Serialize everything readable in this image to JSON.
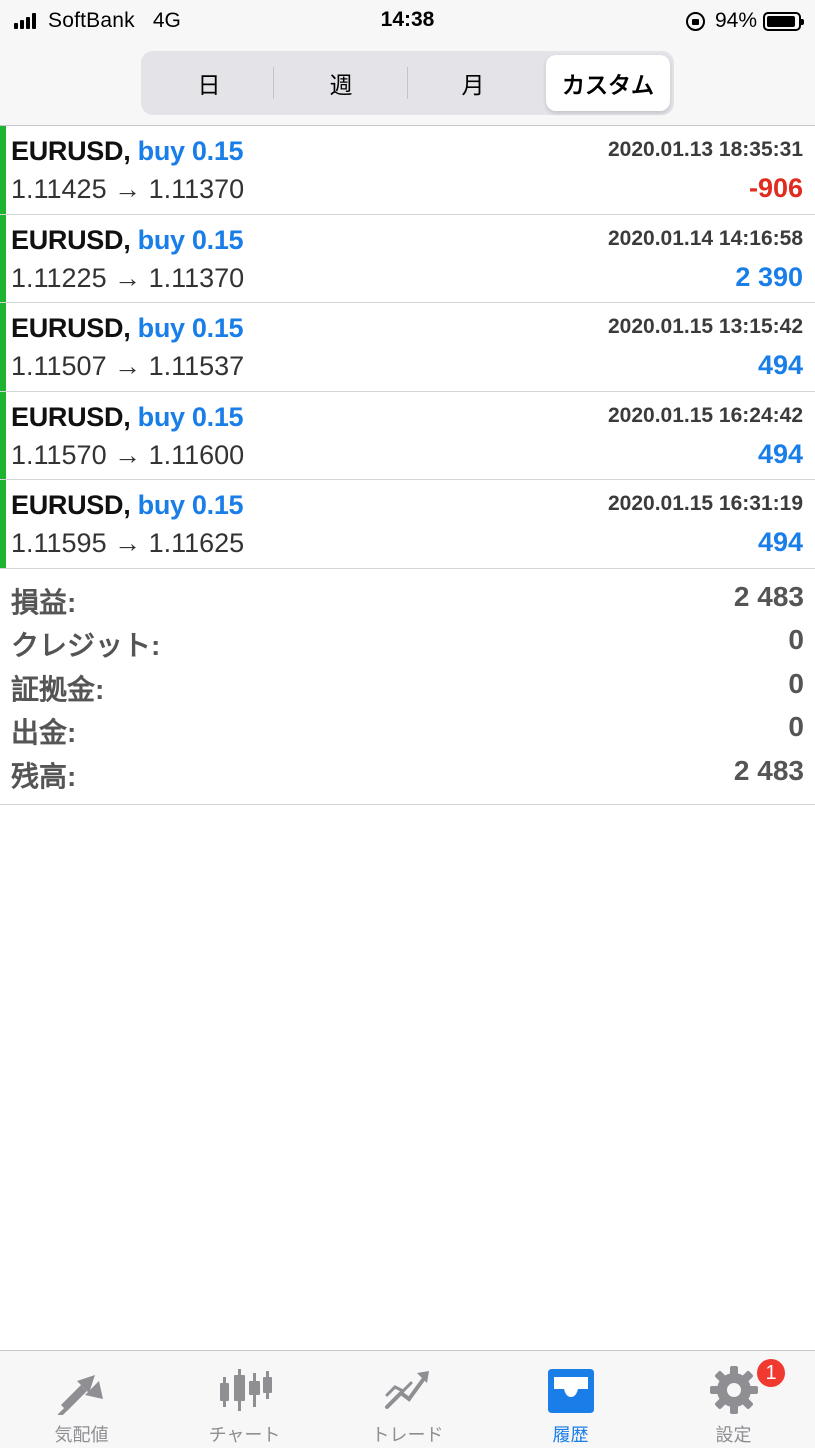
{
  "status_bar": {
    "carrier": "SoftBank",
    "network": "4G",
    "time": "14:38",
    "battery": "94%",
    "battery_level": 0.94
  },
  "period_tabs": {
    "items": [
      "日",
      "週",
      "月",
      "カスタム"
    ],
    "selected": "カスタム"
  },
  "deals": [
    {
      "symbol": "EURUSD,",
      "type": "buy 0.15",
      "time": "2020.01.13 18:35:31",
      "prices": "1.11425 → 1.11370",
      "profit": "-906",
      "profit_color": "#e02b1e"
    },
    {
      "symbol": "EURUSD,",
      "type": "buy 0.15",
      "time": "2020.01.14 14:16:58",
      "prices": "1.11225 → 1.11370",
      "profit": "2 390",
      "profit_color": "#1a7ee8"
    },
    {
      "symbol": "EURUSD,",
      "type": "buy 0.15",
      "time": "2020.01.15 13:15:42",
      "prices": "1.11507 → 1.11537",
      "profit": "494",
      "profit_color": "#1a7ee8"
    },
    {
      "symbol": "EURUSD,",
      "type": "buy 0.15",
      "time": "2020.01.15 16:24:42",
      "prices": "1.11570 → 1.11600",
      "profit": "494",
      "profit_color": "#1a7ee8"
    },
    {
      "symbol": "EURUSD,",
      "type": "buy 0.15",
      "time": "2020.01.15 16:31:19",
      "prices": "1.11595 → 1.11625",
      "profit": "494",
      "profit_color": "#1a7ee8"
    }
  ],
  "summary": [
    {
      "label": "損益:",
      "value": "2 483"
    },
    {
      "label": "クレジット:",
      "value": "0"
    },
    {
      "label": "証拠金:",
      "value": "0"
    },
    {
      "label": "出金:",
      "value": "0"
    },
    {
      "label": "残高:",
      "value": "2 483"
    }
  ],
  "tab_bar": {
    "items": [
      {
        "label": "気配値",
        "icon": "quotes-icon"
      },
      {
        "label": "チャート",
        "icon": "candlestick-chart-icon"
      },
      {
        "label": "トレード",
        "icon": "trade-icon"
      },
      {
        "label": "履歴",
        "icon": "history-inbox-icon"
      },
      {
        "label": "設定",
        "icon": "gear-icon",
        "badge": "1"
      }
    ],
    "active": "履歴"
  },
  "colors": {
    "accent": "#1a7ee8",
    "loss": "#e02b1e",
    "buy_bar": "#1fb430",
    "inactive_icon": "#8e8e93"
  }
}
